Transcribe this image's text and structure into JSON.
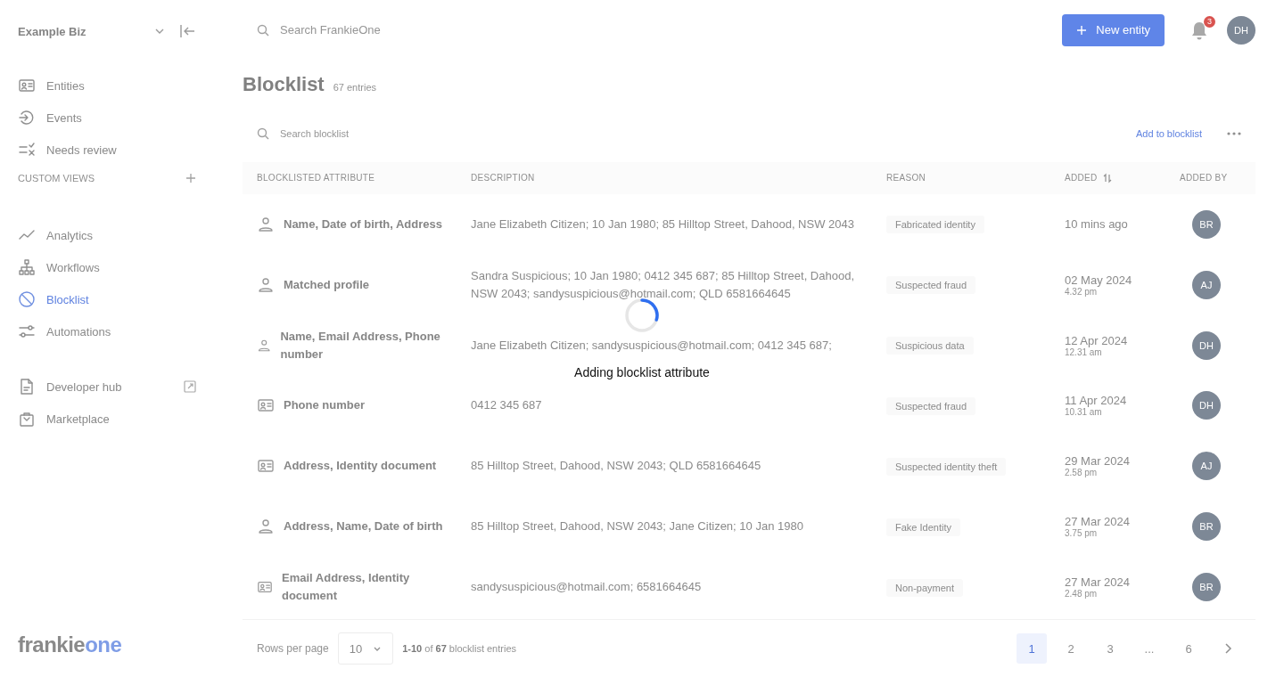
{
  "sidebar": {
    "workspace": "Example Biz",
    "main_items": [
      {
        "label": "Entities",
        "selected": false
      },
      {
        "label": "Events",
        "selected": false
      },
      {
        "label": "Needs review",
        "selected": false
      }
    ],
    "custom_views_label": "CUSTOM VIEWS",
    "tool_items": [
      {
        "label": "Analytics",
        "selected": false
      },
      {
        "label": "Workflows",
        "selected": false
      },
      {
        "label": "Blocklist",
        "selected": true
      },
      {
        "label": "Automations",
        "selected": false
      }
    ],
    "extra_items": [
      {
        "label": "Developer hub",
        "external": true
      },
      {
        "label": "Marketplace",
        "external": false
      }
    ],
    "logo": {
      "part_1": "frankie",
      "part_2": "one"
    }
  },
  "topbar": {
    "search_placeholder": "Search FrankieOne",
    "new_button": "New entity",
    "notification_count": "3",
    "user_initials": "DH"
  },
  "page": {
    "title": "Blocklist",
    "count": "67 entries",
    "search_placeholder": "Search blocklist",
    "add_link": "Add to blocklist"
  },
  "table": {
    "columns": [
      "BLOCKLISTED ATTRIBUTE",
      "DESCRIPTION",
      "REASON",
      "ADDED",
      "ADDED BY"
    ],
    "rows": [
      {
        "kind": "person",
        "attribute": "Name, Date of birth, Address",
        "description": "Jane Elizabeth Citizen; 10 Jan 1980; 85 Hilltop Street, Dahood, NSW 2043",
        "reason": "Fabricated identity",
        "date": "10 mins ago",
        "by": "BR"
      },
      {
        "kind": "person",
        "attribute": "Matched profile",
        "description": "Sandra Suspicious; 10 Jan 1980; 0412 345 687; 85 Hilltop Street, Dahood, NSW 2043; sandysuspicious@hotmail.com; QLD 6581664645",
        "reason": "Suspected fraud",
        "date": "02 May 2024",
        "time": "4.32 pm",
        "by": "AJ"
      },
      {
        "kind": "person",
        "attribute": "Name, Email Address, Phone number",
        "description": "Jane Elizabeth Citizen; sandysuspicious@hotmail.com; 0412 345 687;",
        "reason": "Suspicious data",
        "date": "12 Apr 2024",
        "time": "12.31 am",
        "by": "DH"
      },
      {
        "kind": "document",
        "attribute": "Phone number",
        "description": "0412 345 687",
        "reason": "Suspected fraud",
        "date": "11 Apr 2024",
        "time": "10.31 am",
        "by": "DH"
      },
      {
        "kind": "document",
        "attribute": "Address, Identity document",
        "description": "85 Hilltop Street, Dahood, NSW 2043; QLD 6581664645",
        "reason": "Suspected identity theft",
        "date": "29 Mar 2024",
        "time": "2.58 pm",
        "by": "AJ"
      },
      {
        "kind": "person",
        "attribute": "Address, Name, Date of birth",
        "description": "85 Hilltop Street, Dahood, NSW 2043; Jane Citizen; 10 Jan 1980",
        "reason": "Fake Identity",
        "date": "27 Mar 2024",
        "time": "3.75 pm",
        "by": "BR"
      },
      {
        "kind": "document",
        "attribute": "Email Address, Identity document",
        "description": "sandysuspicious@hotmail.com; 6581664645",
        "reason": "Non-payment",
        "date": "27 Mar 2024",
        "time": "2.48 pm",
        "by": "BR"
      }
    ]
  },
  "footer": {
    "rows_label": "Rows per page",
    "rows_value": "10",
    "range": "1-10",
    "of": "of",
    "total": "67",
    "entries_label": "blocklist entries",
    "pages": [
      {
        "label": "1",
        "selected": true
      },
      {
        "label": "2",
        "selected": false
      },
      {
        "label": "3",
        "selected": false
      },
      {
        "label": "...",
        "selected": false
      },
      {
        "label": "6",
        "selected": false
      }
    ]
  },
  "loading": {
    "message": "Adding blocklist attribute"
  }
}
